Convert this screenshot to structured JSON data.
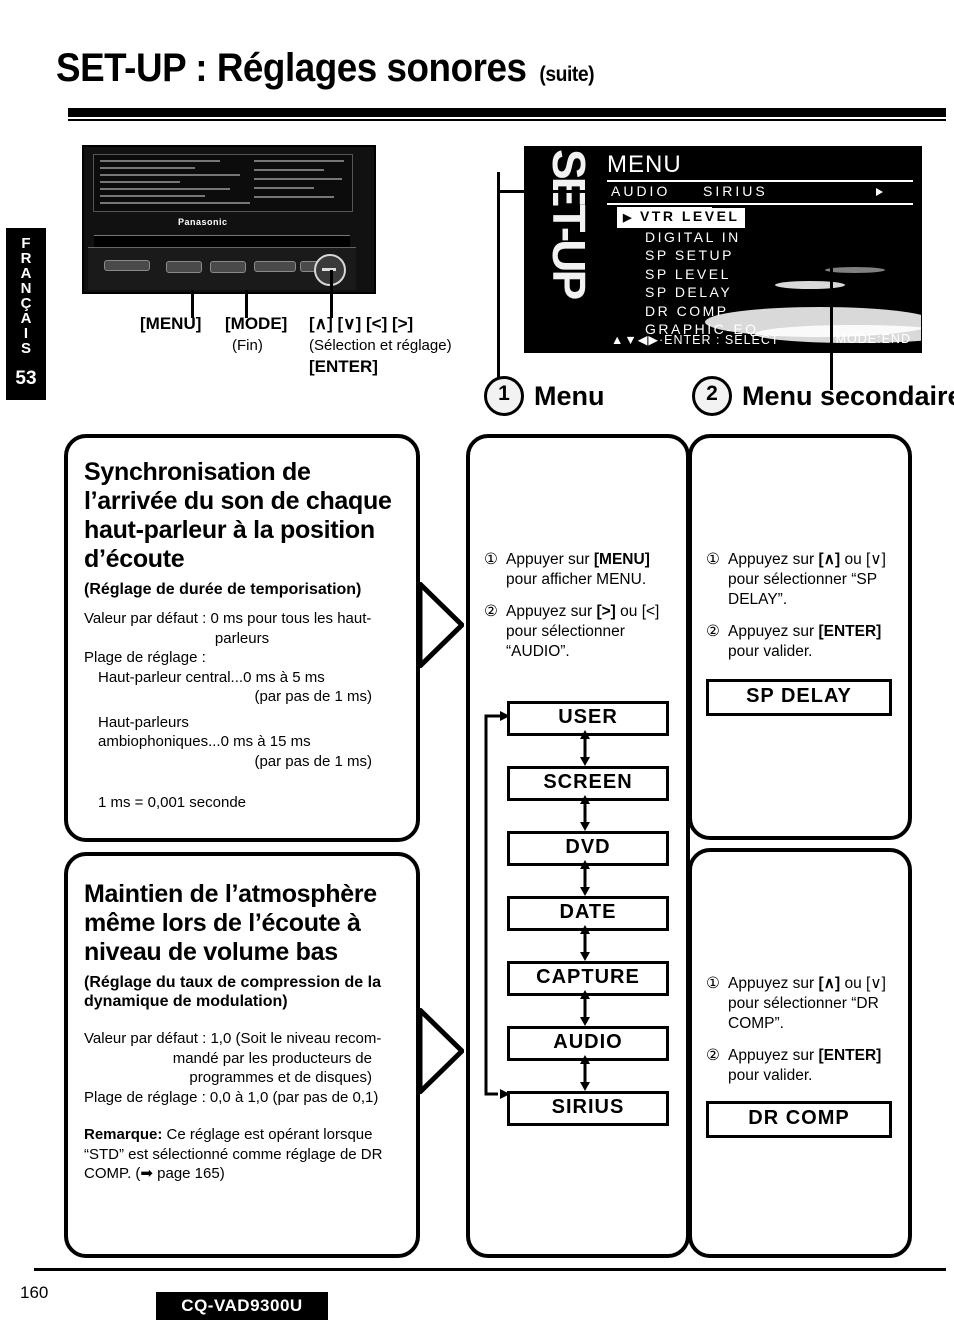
{
  "header": {
    "title": "SET-UP : Réglages sonores",
    "suffix": "(suite)"
  },
  "side_tab": {
    "language": "FRANÇAIS",
    "page_number": "53"
  },
  "unit": {
    "brand": "Panasonic",
    "buttons": [
      {
        "label": "[MENU]",
        "sub": ""
      },
      {
        "label": "[MODE]",
        "sub": "(Fin)"
      },
      {
        "label": "[∧] [∨] [<] [>]",
        "sub": "(Sélection et réglage)"
      },
      {
        "label": "[ENTER]",
        "sub": ""
      }
    ]
  },
  "osd": {
    "setup_word": "SET-UP",
    "title": "MENU",
    "tabs": [
      "AUDIO",
      "SIRIUS"
    ],
    "items": [
      "VTR LEVEL",
      "DIGITAL IN",
      "SP SETUP",
      "SP LEVEL",
      "SP DELAY",
      "DR COMP",
      "GRAPHIC-EQ"
    ],
    "selected_item": "VTR LEVEL",
    "footer_left": "▲▼◀▶·ENTER : SELECT",
    "footer_right": "MODE:END"
  },
  "sections": [
    {
      "number": "1",
      "label": "Menu"
    },
    {
      "number": "2",
      "label": "Menu secondaire"
    }
  ],
  "left_panels": [
    {
      "title": "Synchronisation de l’arrivée du son de chaque haut-parleur à la position d’écoute",
      "subtitle": "(Réglage de durée de temporisation)",
      "body": [
        "Valeur par défaut : 0 ms pour tous les haut-",
        "parleurs",
        "Plage de réglage :",
        "Haut-parleur central...0 ms à 5 ms",
        "(par pas de 1 ms)",
        "Haut-parleurs",
        "ambiophoniques...0 ms à 15 ms",
        "(par pas de 1 ms)",
        "1 ms = 0,001 seconde"
      ]
    },
    {
      "title": "Maintien de l’atmosphère même lors de l’écoute à niveau de volume bas",
      "subtitle": "(Réglage du taux de compression de la dynamique de modulation)",
      "body": [
        "Valeur par défaut : 1,0 (Soit le niveau recom-",
        "mandé par les producteurs de",
        "programmes et de disques)",
        "Plage de réglage : 0,0 à 1,0 (par pas de 0,1)"
      ],
      "note_label": "Remarque:",
      "note_text": " Ce réglage est opérant lorsque “STD” est sélectionné comme réglage de DR COMP.  (➡ page 165)"
    }
  ],
  "menu_column": {
    "steps": [
      {
        "num": "①",
        "text_before": "Appuyer sur ",
        "key": "[MENU]",
        "text_after": " pour afficher MENU."
      },
      {
        "num": "②",
        "text_before": "Appuyez sur ",
        "key": "[>]",
        "text_after": " ou [<] pour sélectionner “AUDIO”."
      }
    ],
    "flow_items": [
      "USER",
      "SCREEN",
      "DVD",
      "DATE",
      "CAPTURE",
      "AUDIO",
      "SIRIUS"
    ]
  },
  "submenu_column": {
    "blocks": [
      {
        "steps": [
          {
            "num": "①",
            "text_before": "Appuyez sur ",
            "key": "[∧]",
            "text_after": " ou [∨] pour sélectionner “SP DELAY”."
          },
          {
            "num": "②",
            "text_before": "Appuyez sur ",
            "key": "[ENTER]",
            "text_after": " pour valider."
          }
        ],
        "result": "SP DELAY"
      },
      {
        "steps": [
          {
            "num": "①",
            "text_before": "Appuyez sur ",
            "key": "[∧]",
            "text_after": " ou [∨] pour sélectionner “DR COMP”."
          },
          {
            "num": "②",
            "text_before": "Appuyez sur ",
            "key": "[ENTER]",
            "text_after": " pour valider."
          }
        ],
        "result": "DR COMP"
      }
    ]
  },
  "footer": {
    "page_number": "160",
    "model": "CQ-VAD9300U"
  }
}
